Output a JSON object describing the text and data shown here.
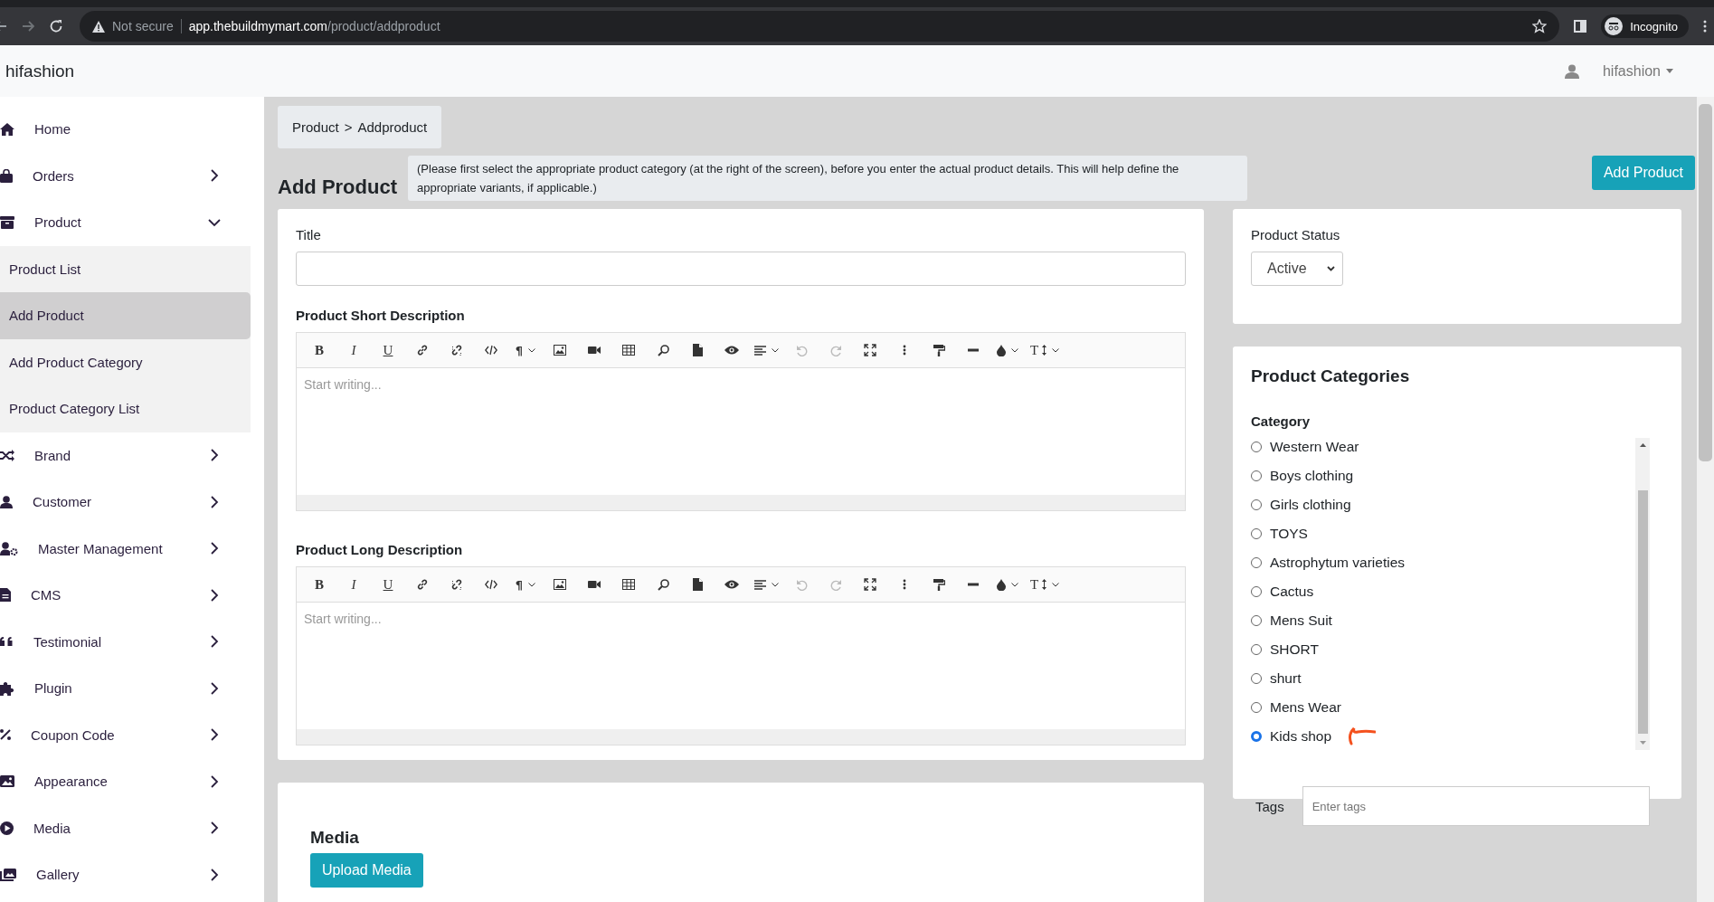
{
  "browser": {
    "security": "Not secure",
    "url_host": "app.thebuildmymart.com",
    "url_path": "/product/addproduct",
    "profile": "Incognito"
  },
  "header": {
    "brand": "hifashion",
    "user": "hifashion"
  },
  "sidebar": {
    "items": [
      {
        "label": "Home",
        "selected": false
      },
      {
        "label": "Orders",
        "selected": false,
        "expanded": false
      },
      {
        "label": "Product",
        "selected": false,
        "expanded": true,
        "children": [
          {
            "label": "Product List",
            "selected": false
          },
          {
            "label": "Add Product",
            "selected": true
          },
          {
            "label": "Add Product Category",
            "selected": false
          },
          {
            "label": "Product Category List",
            "selected": false
          }
        ]
      },
      {
        "label": "Brand",
        "selected": false,
        "expanded": false
      },
      {
        "label": "Customer",
        "selected": false,
        "expanded": false
      },
      {
        "label": "Master Management",
        "selected": false,
        "expanded": false
      },
      {
        "label": "CMS",
        "selected": false,
        "expanded": false
      },
      {
        "label": "Testimonial",
        "selected": false,
        "expanded": false
      },
      {
        "label": "Plugin",
        "selected": false,
        "expanded": false
      },
      {
        "label": "Coupon Code",
        "selected": false,
        "expanded": false
      },
      {
        "label": "Appearance",
        "selected": false,
        "expanded": false
      },
      {
        "label": "Media",
        "selected": false,
        "expanded": false
      },
      {
        "label": "Gallery",
        "selected": false,
        "expanded": false
      }
    ]
  },
  "breadcrumb": [
    "Product",
    ">",
    "Addproduct"
  ],
  "page_title": "Add Product",
  "notice": "(Please first select the appropriate product category (at the right of the screen), before you enter the actual product details. This will help define the appropriate variants, if applicable.)",
  "primary_button": "Add Product",
  "form": {
    "title_label": "Title",
    "editors": [
      {
        "label": "Product Short Description",
        "placeholder": "Start writing...",
        "toolbar": [
          {
            "kind": "bold",
            "label": "B",
            "disabled": false
          },
          {
            "kind": "italic",
            "label": "I",
            "disabled": false
          },
          {
            "kind": "underline",
            "label": "U",
            "disabled": false
          },
          {
            "kind": "link",
            "disabled": false
          },
          {
            "kind": "unlink",
            "disabled": false
          },
          {
            "kind": "code",
            "disabled": false
          },
          {
            "kind": "paragraph",
            "label": "¶",
            "menu": true,
            "disabled": false
          },
          {
            "kind": "image",
            "disabled": false
          },
          {
            "kind": "video",
            "disabled": false
          },
          {
            "kind": "table",
            "disabled": false
          },
          {
            "kind": "search",
            "disabled": false
          },
          {
            "kind": "file",
            "disabled": false
          },
          {
            "kind": "preview",
            "disabled": false
          },
          {
            "kind": "align",
            "menu": true,
            "disabled": false
          },
          {
            "kind": "undo",
            "disabled": true
          },
          {
            "kind": "redo",
            "disabled": true
          },
          {
            "kind": "fullscreen",
            "disabled": false
          },
          {
            "kind": "more",
            "disabled": false
          },
          {
            "kind": "format",
            "disabled": false
          },
          {
            "kind": "rule",
            "disabled": false
          },
          {
            "kind": "color",
            "menu": true,
            "disabled": false
          },
          {
            "kind": "textsize",
            "label": "T",
            "menu": true,
            "disabled": false
          }
        ]
      },
      {
        "label": "Product Long Description",
        "placeholder": "Start writing...",
        "toolbar": [
          {
            "kind": "bold",
            "label": "B",
            "disabled": false
          },
          {
            "kind": "italic",
            "label": "I",
            "disabled": false
          },
          {
            "kind": "underline",
            "label": "U",
            "disabled": false
          },
          {
            "kind": "link",
            "disabled": false
          },
          {
            "kind": "unlink",
            "disabled": false
          },
          {
            "kind": "code",
            "disabled": false
          },
          {
            "kind": "paragraph",
            "label": "¶",
            "menu": true,
            "disabled": false
          },
          {
            "kind": "image",
            "disabled": false
          },
          {
            "kind": "video",
            "disabled": false
          },
          {
            "kind": "table",
            "disabled": false
          },
          {
            "kind": "search",
            "disabled": false
          },
          {
            "kind": "file",
            "disabled": false
          },
          {
            "kind": "preview",
            "disabled": false
          },
          {
            "kind": "align",
            "menu": true,
            "disabled": false
          },
          {
            "kind": "undo",
            "disabled": true
          },
          {
            "kind": "redo",
            "disabled": true
          },
          {
            "kind": "fullscreen",
            "disabled": false
          },
          {
            "kind": "more",
            "disabled": false
          },
          {
            "kind": "format",
            "disabled": false
          },
          {
            "kind": "rule",
            "disabled": false
          },
          {
            "kind": "color",
            "menu": true,
            "disabled": false
          },
          {
            "kind": "textsize",
            "label": "T",
            "menu": true,
            "disabled": false
          }
        ]
      }
    ]
  },
  "media": {
    "title": "Media",
    "button": "Upload Media"
  },
  "status": {
    "label": "Product Status",
    "value": "Active"
  },
  "categories": {
    "title": "Product Categories",
    "label": "Category",
    "items": [
      {
        "label": "Western Wear",
        "selected": false
      },
      {
        "label": "Boys clothing",
        "selected": false
      },
      {
        "label": "Girls clothing",
        "selected": false
      },
      {
        "label": "TOYS",
        "selected": false
      },
      {
        "label": "Astrophytum varieties",
        "selected": false
      },
      {
        "label": "Cactus",
        "selected": false
      },
      {
        "label": "Mens Suit",
        "selected": false
      },
      {
        "label": "SHORT",
        "selected": false
      },
      {
        "label": "shurt",
        "selected": false
      },
      {
        "label": "Mens Wear",
        "selected": false
      },
      {
        "label": "Kids shop",
        "selected": true
      }
    ],
    "annotation": {
      "color": "#f4511e"
    }
  },
  "tags": {
    "label": "Tags",
    "placeholder": "Enter tags"
  }
}
